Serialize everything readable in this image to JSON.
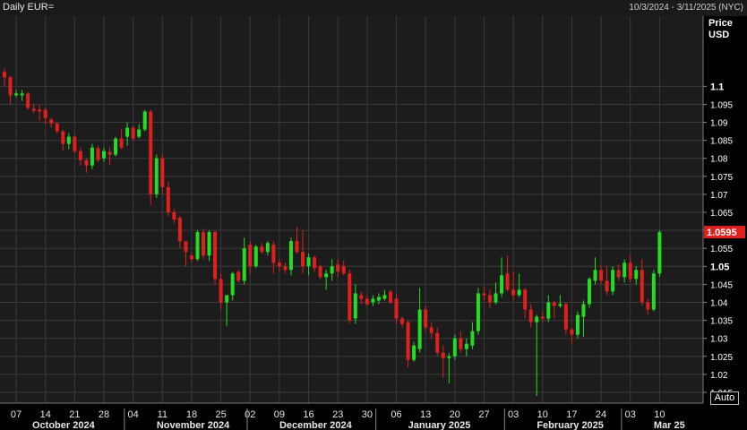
{
  "header": {
    "title": "Daily EUR=",
    "date_range": "10/3/2024 - 3/11/2025 (NYC)"
  },
  "axis": {
    "price_label": [
      "Price",
      "USD"
    ],
    "auto_label": "Auto"
  },
  "colors": {
    "up": "#22dd22",
    "down": "#e0201f",
    "plot_bg": "#1c1c1c",
    "grid": "#3a3a3a",
    "last_price_bg": "#e0201f"
  },
  "chart_data": {
    "type": "candlestick",
    "title": "Daily EUR=",
    "ylim": [
      1.012,
      1.1195
    ],
    "grid": true,
    "last_price": "1.0595",
    "y_ticks": [
      {
        "value": 1.015,
        "label": "1.015",
        "major": false
      },
      {
        "value": 1.02,
        "label": "1.02",
        "major": false
      },
      {
        "value": 1.025,
        "label": "1.025",
        "major": false
      },
      {
        "value": 1.03,
        "label": "1.03",
        "major": false
      },
      {
        "value": 1.035,
        "label": "1.035",
        "major": false
      },
      {
        "value": 1.04,
        "label": "1.04",
        "major": false
      },
      {
        "value": 1.045,
        "label": "1.045",
        "major": false
      },
      {
        "value": 1.05,
        "label": "1.05",
        "major": true
      },
      {
        "value": 1.055,
        "label": "1.055",
        "major": false
      },
      {
        "value": 1.06,
        "label": "1.06",
        "major": false
      },
      {
        "value": 1.065,
        "label": "1.065",
        "major": false
      },
      {
        "value": 1.07,
        "label": "1.07",
        "major": false
      },
      {
        "value": 1.075,
        "label": "1.075",
        "major": false
      },
      {
        "value": 1.08,
        "label": "1.08",
        "major": false
      },
      {
        "value": 1.085,
        "label": "1.085",
        "major": false
      },
      {
        "value": 1.09,
        "label": "1.09",
        "major": false
      },
      {
        "value": 1.095,
        "label": "1.095",
        "major": false
      },
      {
        "value": 1.1,
        "label": "1.1",
        "major": true
      }
    ],
    "x_ticks": [
      {
        "index": 2,
        "label": "07"
      },
      {
        "index": 7,
        "label": "14"
      },
      {
        "index": 12,
        "label": "21"
      },
      {
        "index": 17,
        "label": "28"
      },
      {
        "index": 22,
        "label": "04"
      },
      {
        "index": 27,
        "label": "11"
      },
      {
        "index": 32,
        "label": "18"
      },
      {
        "index": 37,
        "label": "25"
      },
      {
        "index": 42,
        "label": "02"
      },
      {
        "index": 47,
        "label": "09"
      },
      {
        "index": 52,
        "label": "16"
      },
      {
        "index": 57,
        "label": "23"
      },
      {
        "index": 62,
        "label": "30"
      },
      {
        "index": 67,
        "label": "06"
      },
      {
        "index": 72,
        "label": "13"
      },
      {
        "index": 77,
        "label": "20"
      },
      {
        "index": 82,
        "label": "27"
      },
      {
        "index": 87,
        "label": "03"
      },
      {
        "index": 92,
        "label": "10"
      },
      {
        "index": 97,
        "label": "17"
      },
      {
        "index": 102,
        "label": "24"
      },
      {
        "index": 107,
        "label": "03"
      },
      {
        "index": 112,
        "label": "10"
      }
    ],
    "months": [
      {
        "start_index": 0,
        "label": "October 2024"
      },
      {
        "start_index": 21,
        "label": "November 2024"
      },
      {
        "start_index": 42,
        "label": "December 2024"
      },
      {
        "start_index": 64,
        "label": "January 2025"
      },
      {
        "start_index": 86,
        "label": "February 2025"
      },
      {
        "start_index": 106,
        "label": "Mar 25"
      }
    ],
    "candles": [
      {
        "date": "2024-10-03",
        "o": 1.104,
        "h": 1.105,
        "l": 1.1,
        "c": 1.1025
      },
      {
        "date": "2024-10-04",
        "o": 1.1025,
        "h": 1.103,
        "l": 1.095,
        "c": 1.0975
      },
      {
        "date": "2024-10-07",
        "o": 1.0975,
        "h": 1.099,
        "l": 1.097,
        "c": 1.098
      },
      {
        "date": "2024-10-08",
        "o": 1.0975,
        "h": 1.099,
        "l": 1.096,
        "c": 1.098
      },
      {
        "date": "2024-10-09",
        "o": 1.098,
        "h": 1.0985,
        "l": 1.0935,
        "c": 1.094
      },
      {
        "date": "2024-10-10",
        "o": 1.0938,
        "h": 1.095,
        "l": 1.0925,
        "c": 1.0932
      },
      {
        "date": "2024-10-11",
        "o": 1.0935,
        "h": 1.0948,
        "l": 1.0905,
        "c": 1.093
      },
      {
        "date": "2024-10-14",
        "o": 1.0935,
        "h": 1.094,
        "l": 1.0895,
        "c": 1.0912
      },
      {
        "date": "2024-10-15",
        "o": 1.0908,
        "h": 1.0912,
        "l": 1.0885,
        "c": 1.0897
      },
      {
        "date": "2024-10-16",
        "o": 1.0897,
        "h": 1.09,
        "l": 1.087,
        "c": 1.0875
      },
      {
        "date": "2024-10-17",
        "o": 1.0875,
        "h": 1.088,
        "l": 1.082,
        "c": 1.084
      },
      {
        "date": "2024-10-18",
        "o": 1.084,
        "h": 1.087,
        "l": 1.0825,
        "c": 1.086
      },
      {
        "date": "2024-10-21",
        "o": 1.086,
        "h": 1.0865,
        "l": 1.0815,
        "c": 1.082
      },
      {
        "date": "2024-10-22",
        "o": 1.082,
        "h": 1.083,
        "l": 1.078,
        "c": 1.0795
      },
      {
        "date": "2024-10-23",
        "o": 1.0795,
        "h": 1.08,
        "l": 1.076,
        "c": 1.078
      },
      {
        "date": "2024-10-24",
        "o": 1.078,
        "h": 1.084,
        "l": 1.077,
        "c": 1.083
      },
      {
        "date": "2024-10-25",
        "o": 1.0828,
        "h": 1.0835,
        "l": 1.079,
        "c": 1.0795
      },
      {
        "date": "2024-10-28",
        "o": 1.08,
        "h": 1.083,
        "l": 1.079,
        "c": 1.082
      },
      {
        "date": "2024-10-29",
        "o": 1.0818,
        "h": 1.083,
        "l": 1.078,
        "c": 1.081
      },
      {
        "date": "2024-10-30",
        "o": 1.081,
        "h": 1.086,
        "l": 1.0805,
        "c": 1.0855
      },
      {
        "date": "2024-10-31",
        "o": 1.0855,
        "h": 1.088,
        "l": 1.0825,
        "c": 1.083
      },
      {
        "date": "2024-11-01",
        "o": 1.086,
        "h": 1.09,
        "l": 1.0835,
        "c": 1.0885
      },
      {
        "date": "2024-11-04",
        "o": 1.0885,
        "h": 1.089,
        "l": 1.085,
        "c": 1.0855
      },
      {
        "date": "2024-11-05",
        "o": 1.086,
        "h": 1.0895,
        "l": 1.0855,
        "c": 1.088
      },
      {
        "date": "2024-11-06",
        "o": 1.088,
        "h": 1.0935,
        "l": 1.0875,
        "c": 1.093
      },
      {
        "date": "2024-11-07",
        "o": 1.093,
        "h": 1.0935,
        "l": 1.067,
        "c": 1.07
      },
      {
        "date": "2024-11-08",
        "o": 1.07,
        "h": 1.081,
        "l": 1.069,
        "c": 1.08
      },
      {
        "date": "2024-11-11",
        "o": 1.08,
        "h": 1.081,
        "l": 1.07,
        "c": 1.072
      },
      {
        "date": "2024-11-12",
        "o": 1.072,
        "h": 1.0735,
        "l": 1.064,
        "c": 1.065
      },
      {
        "date": "2024-11-13",
        "o": 1.065,
        "h": 1.066,
        "l": 1.062,
        "c": 1.063
      },
      {
        "date": "2024-11-14",
        "o": 1.0635,
        "h": 1.064,
        "l": 1.055,
        "c": 1.057
      },
      {
        "date": "2024-11-15",
        "o": 1.057,
        "h": 1.0565,
        "l": 1.05,
        "c": 1.054
      },
      {
        "date": "2024-11-18",
        "o": 1.053,
        "h": 1.054,
        "l": 1.051,
        "c": 1.052
      },
      {
        "date": "2024-11-19",
        "o": 1.052,
        "h": 1.06,
        "l": 1.0515,
        "c": 1.0595
      },
      {
        "date": "2024-11-20",
        "o": 1.0595,
        "h": 1.0605,
        "l": 1.052,
        "c": 1.053
      },
      {
        "date": "2024-11-21",
        "o": 1.053,
        "h": 1.06,
        "l": 1.0515,
        "c": 1.0595
      },
      {
        "date": "2024-11-22",
        "o": 1.0595,
        "h": 1.06,
        "l": 1.045,
        "c": 1.0465
      },
      {
        "date": "2024-11-25",
        "o": 1.0465,
        "h": 1.048,
        "l": 1.038,
        "c": 1.04
      },
      {
        "date": "2024-11-26",
        "o": 1.04,
        "h": 1.041,
        "l": 1.0335,
        "c": 1.042
      },
      {
        "date": "2024-11-27",
        "o": 1.042,
        "h": 1.0485,
        "l": 1.0405,
        "c": 1.048
      },
      {
        "date": "2024-11-28",
        "o": 1.0485,
        "h": 1.049,
        "l": 1.0455,
        "c": 1.046
      },
      {
        "date": "2024-11-29",
        "o": 1.046,
        "h": 1.058,
        "l": 1.045,
        "c": 1.055
      },
      {
        "date": "2024-12-02",
        "o": 1.056,
        "h": 1.057,
        "l": 1.048,
        "c": 1.05
      },
      {
        "date": "2024-12-03",
        "o": 1.05,
        "h": 1.056,
        "l": 1.0495,
        "c": 1.0555
      },
      {
        "date": "2024-12-04",
        "o": 1.0555,
        "h": 1.0565,
        "l": 1.0535,
        "c": 1.054
      },
      {
        "date": "2024-12-05",
        "o": 1.054,
        "h": 1.057,
        "l": 1.053,
        "c": 1.0565
      },
      {
        "date": "2024-12-06",
        "o": 1.056,
        "h": 1.057,
        "l": 1.048,
        "c": 1.051
      },
      {
        "date": "2024-12-09",
        "o": 1.051,
        "h": 1.052,
        "l": 1.0485,
        "c": 1.05
      },
      {
        "date": "2024-12-10",
        "o": 1.05,
        "h": 1.051,
        "l": 1.048,
        "c": 1.049
      },
      {
        "date": "2024-12-11",
        "o": 1.049,
        "h": 1.058,
        "l": 1.0475,
        "c": 1.057
      },
      {
        "date": "2024-12-12",
        "o": 1.057,
        "h": 1.061,
        "l": 1.0535,
        "c": 1.054
      },
      {
        "date": "2024-12-13",
        "o": 1.054,
        "h": 1.06,
        "l": 1.048,
        "c": 1.05
      },
      {
        "date": "2024-12-16",
        "o": 1.05,
        "h": 1.0535,
        "l": 1.0475,
        "c": 1.0525
      },
      {
        "date": "2024-12-17",
        "o": 1.0525,
        "h": 1.053,
        "l": 1.0485,
        "c": 1.0495
      },
      {
        "date": "2024-12-18",
        "o": 1.05,
        "h": 1.0505,
        "l": 1.0465,
        "c": 1.047
      },
      {
        "date": "2024-12-19",
        "o": 1.047,
        "h": 1.049,
        "l": 1.0435,
        "c": 1.048
      },
      {
        "date": "2024-12-20",
        "o": 1.048,
        "h": 1.052,
        "l": 1.046,
        "c": 1.05
      },
      {
        "date": "2024-12-23",
        "o": 1.0505,
        "h": 1.052,
        "l": 1.047,
        "c": 1.0485
      },
      {
        "date": "2024-12-24",
        "o": 1.05,
        "h": 1.0515,
        "l": 1.0475,
        "c": 1.048
      },
      {
        "date": "2024-12-26",
        "o": 1.048,
        "h": 1.049,
        "l": 1.034,
        "c": 1.035
      },
      {
        "date": "2024-12-27",
        "o": 1.0355,
        "h": 1.045,
        "l": 1.034,
        "c": 1.0425
      },
      {
        "date": "2024-12-30",
        "o": 1.042,
        "h": 1.043,
        "l": 1.0395,
        "c": 1.041
      },
      {
        "date": "2024-12-31",
        "o": 1.041,
        "h": 1.042,
        "l": 1.039,
        "c": 1.0395
      },
      {
        "date": "2025-01-01",
        "o": 1.04,
        "h": 1.042,
        "l": 1.039,
        "c": 1.041
      },
      {
        "date": "2025-01-02",
        "o": 1.0405,
        "h": 1.0425,
        "l": 1.0395,
        "c": 1.0415
      },
      {
        "date": "2025-01-03",
        "o": 1.041,
        "h": 1.0435,
        "l": 1.0405,
        "c": 1.042
      },
      {
        "date": "2025-01-06",
        "o": 1.043,
        "h": 1.0435,
        "l": 1.0395,
        "c": 1.04
      },
      {
        "date": "2025-01-07",
        "o": 1.041,
        "h": 1.0425,
        "l": 1.034,
        "c": 1.0355
      },
      {
        "date": "2025-01-08",
        "o": 1.0355,
        "h": 1.036,
        "l": 1.033,
        "c": 1.034
      },
      {
        "date": "2025-01-09",
        "o": 1.0345,
        "h": 1.035,
        "l": 1.022,
        "c": 1.024
      },
      {
        "date": "2025-01-10",
        "o": 1.024,
        "h": 1.029,
        "l": 1.0235,
        "c": 1.028
      },
      {
        "date": "2025-01-13",
        "o": 1.027,
        "h": 1.044,
        "l": 1.026,
        "c": 1.038
      },
      {
        "date": "2025-01-14",
        "o": 1.038,
        "h": 1.039,
        "l": 1.032,
        "c": 1.033
      },
      {
        "date": "2025-01-15",
        "o": 1.033,
        "h": 1.0345,
        "l": 1.03,
        "c": 1.0315
      },
      {
        "date": "2025-01-16",
        "o": 1.0315,
        "h": 1.033,
        "l": 1.025,
        "c": 1.026
      },
      {
        "date": "2025-01-17",
        "o": 1.026,
        "h": 1.028,
        "l": 1.019,
        "c": 1.0245
      },
      {
        "date": "2025-01-20",
        "o": 1.0245,
        "h": 1.026,
        "l": 1.0175,
        "c": 1.025
      },
      {
        "date": "2025-01-21",
        "o": 1.025,
        "h": 1.031,
        "l": 1.024,
        "c": 1.03
      },
      {
        "date": "2025-01-22",
        "o": 1.03,
        "h": 1.032,
        "l": 1.026,
        "c": 1.027
      },
      {
        "date": "2025-01-23",
        "o": 1.027,
        "h": 1.03,
        "l": 1.025,
        "c": 1.0285
      },
      {
        "date": "2025-01-24",
        "o": 1.028,
        "h": 1.0345,
        "l": 1.027,
        "c": 1.032
      },
      {
        "date": "2025-01-27",
        "o": 1.032,
        "h": 1.044,
        "l": 1.031,
        "c": 1.0425
      },
      {
        "date": "2025-01-28",
        "o": 1.0425,
        "h": 1.0445,
        "l": 1.0405,
        "c": 1.042
      },
      {
        "date": "2025-01-29",
        "o": 1.042,
        "h": 1.0435,
        "l": 1.0385,
        "c": 1.04
      },
      {
        "date": "2025-01-30",
        "o": 1.04,
        "h": 1.0455,
        "l": 1.0395,
        "c": 1.0425
      },
      {
        "date": "2025-01-31",
        "o": 1.0425,
        "h": 1.0525,
        "l": 1.0415,
        "c": 1.0475
      },
      {
        "date": "2025-02-03",
        "o": 1.048,
        "h": 1.053,
        "l": 1.043,
        "c": 1.0435
      },
      {
        "date": "2025-02-04",
        "o": 1.0435,
        "h": 1.0485,
        "l": 1.0405,
        "c": 1.042
      },
      {
        "date": "2025-02-05",
        "o": 1.042,
        "h": 1.048,
        "l": 1.0415,
        "c": 1.0435
      },
      {
        "date": "2025-02-06",
        "o": 1.0435,
        "h": 1.044,
        "l": 1.0355,
        "c": 1.038
      },
      {
        "date": "2025-02-07",
        "o": 1.038,
        "h": 1.0395,
        "l": 1.033,
        "c": 1.0345
      },
      {
        "date": "2025-02-10",
        "o": 1.0345,
        "h": 1.0365,
        "l": 1.014,
        "c": 1.036
      },
      {
        "date": "2025-02-11",
        "o": 1.036,
        "h": 1.0375,
        "l": 1.0345,
        "c": 1.0355
      },
      {
        "date": "2025-02-12",
        "o": 1.0355,
        "h": 1.042,
        "l": 1.0345,
        "c": 1.04
      },
      {
        "date": "2025-02-13",
        "o": 1.04,
        "h": 1.0405,
        "l": 1.0355,
        "c": 1.039
      },
      {
        "date": "2025-02-14",
        "o": 1.039,
        "h": 1.042,
        "l": 1.0385,
        "c": 1.0395
      },
      {
        "date": "2025-02-17",
        "o": 1.0395,
        "h": 1.04,
        "l": 1.031,
        "c": 1.0325
      },
      {
        "date": "2025-02-18",
        "o": 1.0325,
        "h": 1.033,
        "l": 1.0285,
        "c": 1.031
      },
      {
        "date": "2025-02-19",
        "o": 1.031,
        "h": 1.0375,
        "l": 1.03,
        "c": 1.0365
      },
      {
        "date": "2025-02-20",
        "o": 1.036,
        "h": 1.0405,
        "l": 1.0305,
        "c": 1.0395
      },
      {
        "date": "2025-02-21",
        "o": 1.0395,
        "h": 1.047,
        "l": 1.0385,
        "c": 1.0465
      },
      {
        "date": "2025-02-24",
        "o": 1.046,
        "h": 1.0525,
        "l": 1.045,
        "c": 1.049
      },
      {
        "date": "2025-02-25",
        "o": 1.049,
        "h": 1.0505,
        "l": 1.045,
        "c": 1.046
      },
      {
        "date": "2025-02-26",
        "o": 1.046,
        "h": 1.05,
        "l": 1.042,
        "c": 1.043
      },
      {
        "date": "2025-02-27",
        "o": 1.043,
        "h": 1.05,
        "l": 1.042,
        "c": 1.049
      },
      {
        "date": "2025-02-28",
        "o": 1.049,
        "h": 1.0505,
        "l": 1.046,
        "c": 1.047
      },
      {
        "date": "2025-03-03",
        "o": 1.047,
        "h": 1.052,
        "l": 1.0455,
        "c": 1.051
      },
      {
        "date": "2025-03-04",
        "o": 1.051,
        "h": 1.053,
        "l": 1.0455,
        "c": 1.0465
      },
      {
        "date": "2025-03-05",
        "o": 1.0465,
        "h": 1.05,
        "l": 1.045,
        "c": 1.049
      },
      {
        "date": "2025-03-06",
        "o": 1.049,
        "h": 1.052,
        "l": 1.039,
        "c": 1.04
      },
      {
        "date": "2025-03-07",
        "o": 1.04,
        "h": 1.041,
        "l": 1.0365,
        "c": 1.038
      },
      {
        "date": "2025-03-10",
        "o": 1.038,
        "h": 1.049,
        "l": 1.0375,
        "c": 1.048
      },
      {
        "date": "2025-03-11",
        "o": 1.048,
        "h": 1.06,
        "l": 1.047,
        "c": 1.0595
      }
    ]
  }
}
